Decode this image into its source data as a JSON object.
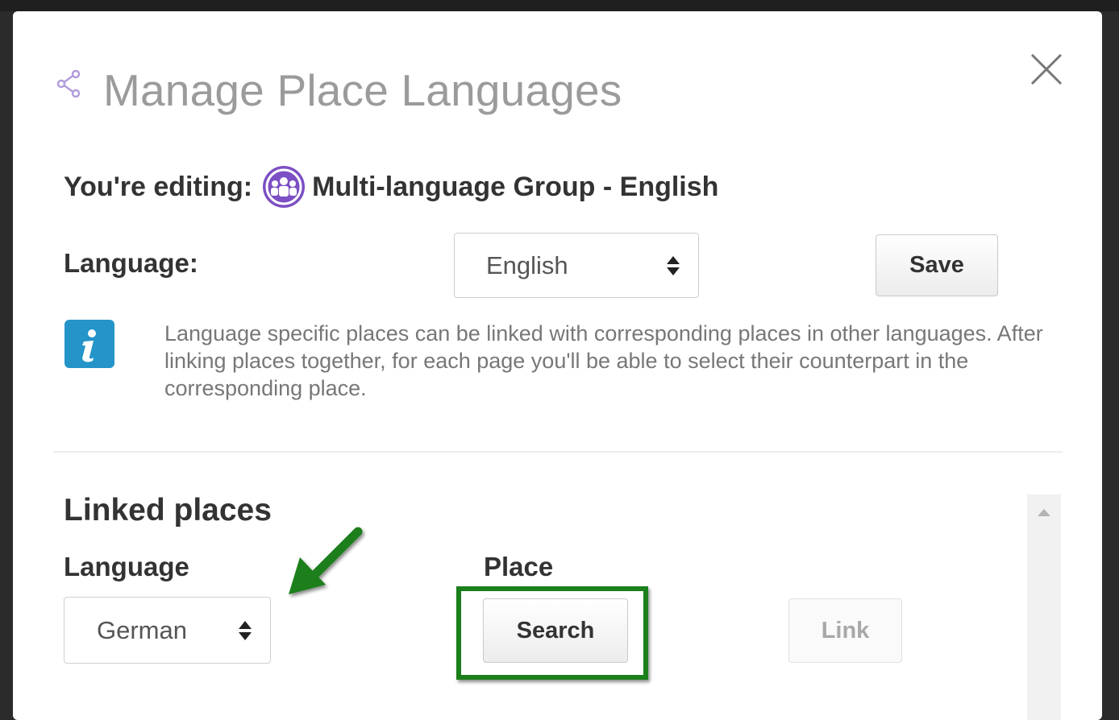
{
  "dialog": {
    "title": "Manage Place Languages",
    "title_icon": "share-icon",
    "close_icon": "close-icon"
  },
  "editing": {
    "prefix": "You're editing:",
    "group_icon": "group-avatar-icon",
    "group_name": "Multi-language Group - English"
  },
  "language_setting": {
    "label": "Language:",
    "selected": "English",
    "save_label": "Save"
  },
  "info": {
    "icon": "info-icon",
    "text": "Language specific places can be linked with corresponding places in other languages. After linking places together, for each page you'll be able to select their counterpart in the corresponding place."
  },
  "linked_places": {
    "heading": "Linked places",
    "language_col": "Language",
    "place_col": "Place",
    "language_selected": "German",
    "search_label": "Search",
    "link_label": "Link"
  },
  "colors": {
    "accent_info": "#2494c9",
    "avatar_purple": "#7c4fc4",
    "annotation_green": "#1b7f1b"
  }
}
